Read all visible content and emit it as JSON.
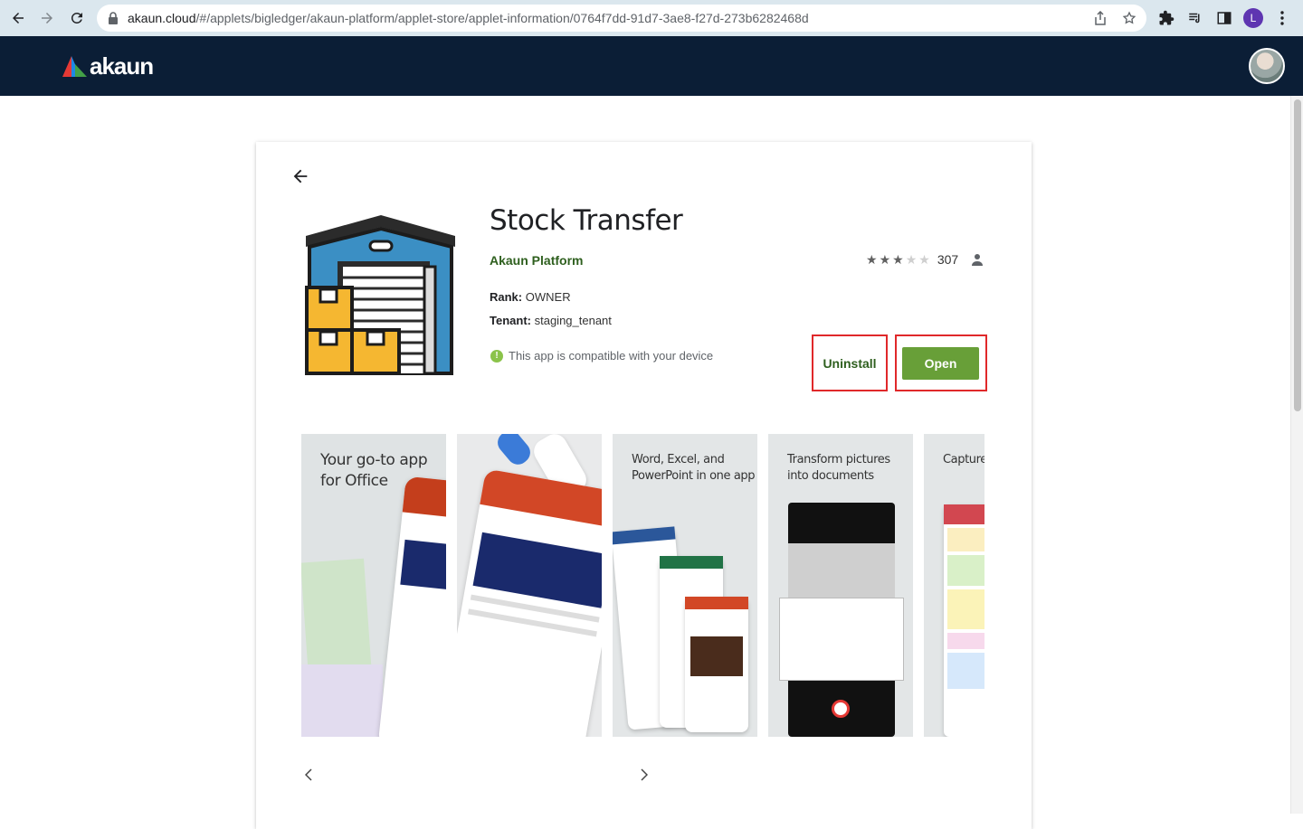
{
  "browser": {
    "url_domain": "akaun.cloud",
    "url_path": "/#/applets/bigledger/akaun-platform/applet-store/applet-information/0764f7dd-91d7-3ae8-f27d-273b6282468d",
    "profile_initial": "L"
  },
  "header": {
    "logo_text": "akaun"
  },
  "app": {
    "title": "Stock Transfer",
    "publisher": "Akaun Platform",
    "rating_stars": 3,
    "rating_max": 5,
    "rating_count": "307",
    "rank_label": "Rank:",
    "rank_value": "OWNER",
    "tenant_label": "Tenant:",
    "tenant_value": "staging_tenant",
    "compat_text": "This app is compatible with your device",
    "uninstall_label": "Uninstall",
    "open_label": "Open"
  },
  "screenshots": [
    {
      "caption": "Your go-to app for Office"
    },
    {
      "caption": ""
    },
    {
      "caption": "Word, Excel, and PowerPoint in one app"
    },
    {
      "caption": "Transform pictures into documents"
    },
    {
      "caption": "Capture and ide"
    }
  ],
  "colors": {
    "header_bg": "#0b1e36",
    "publisher": "#2e5f1e",
    "open_button": "#689f38",
    "highlight": "#e0282a"
  }
}
